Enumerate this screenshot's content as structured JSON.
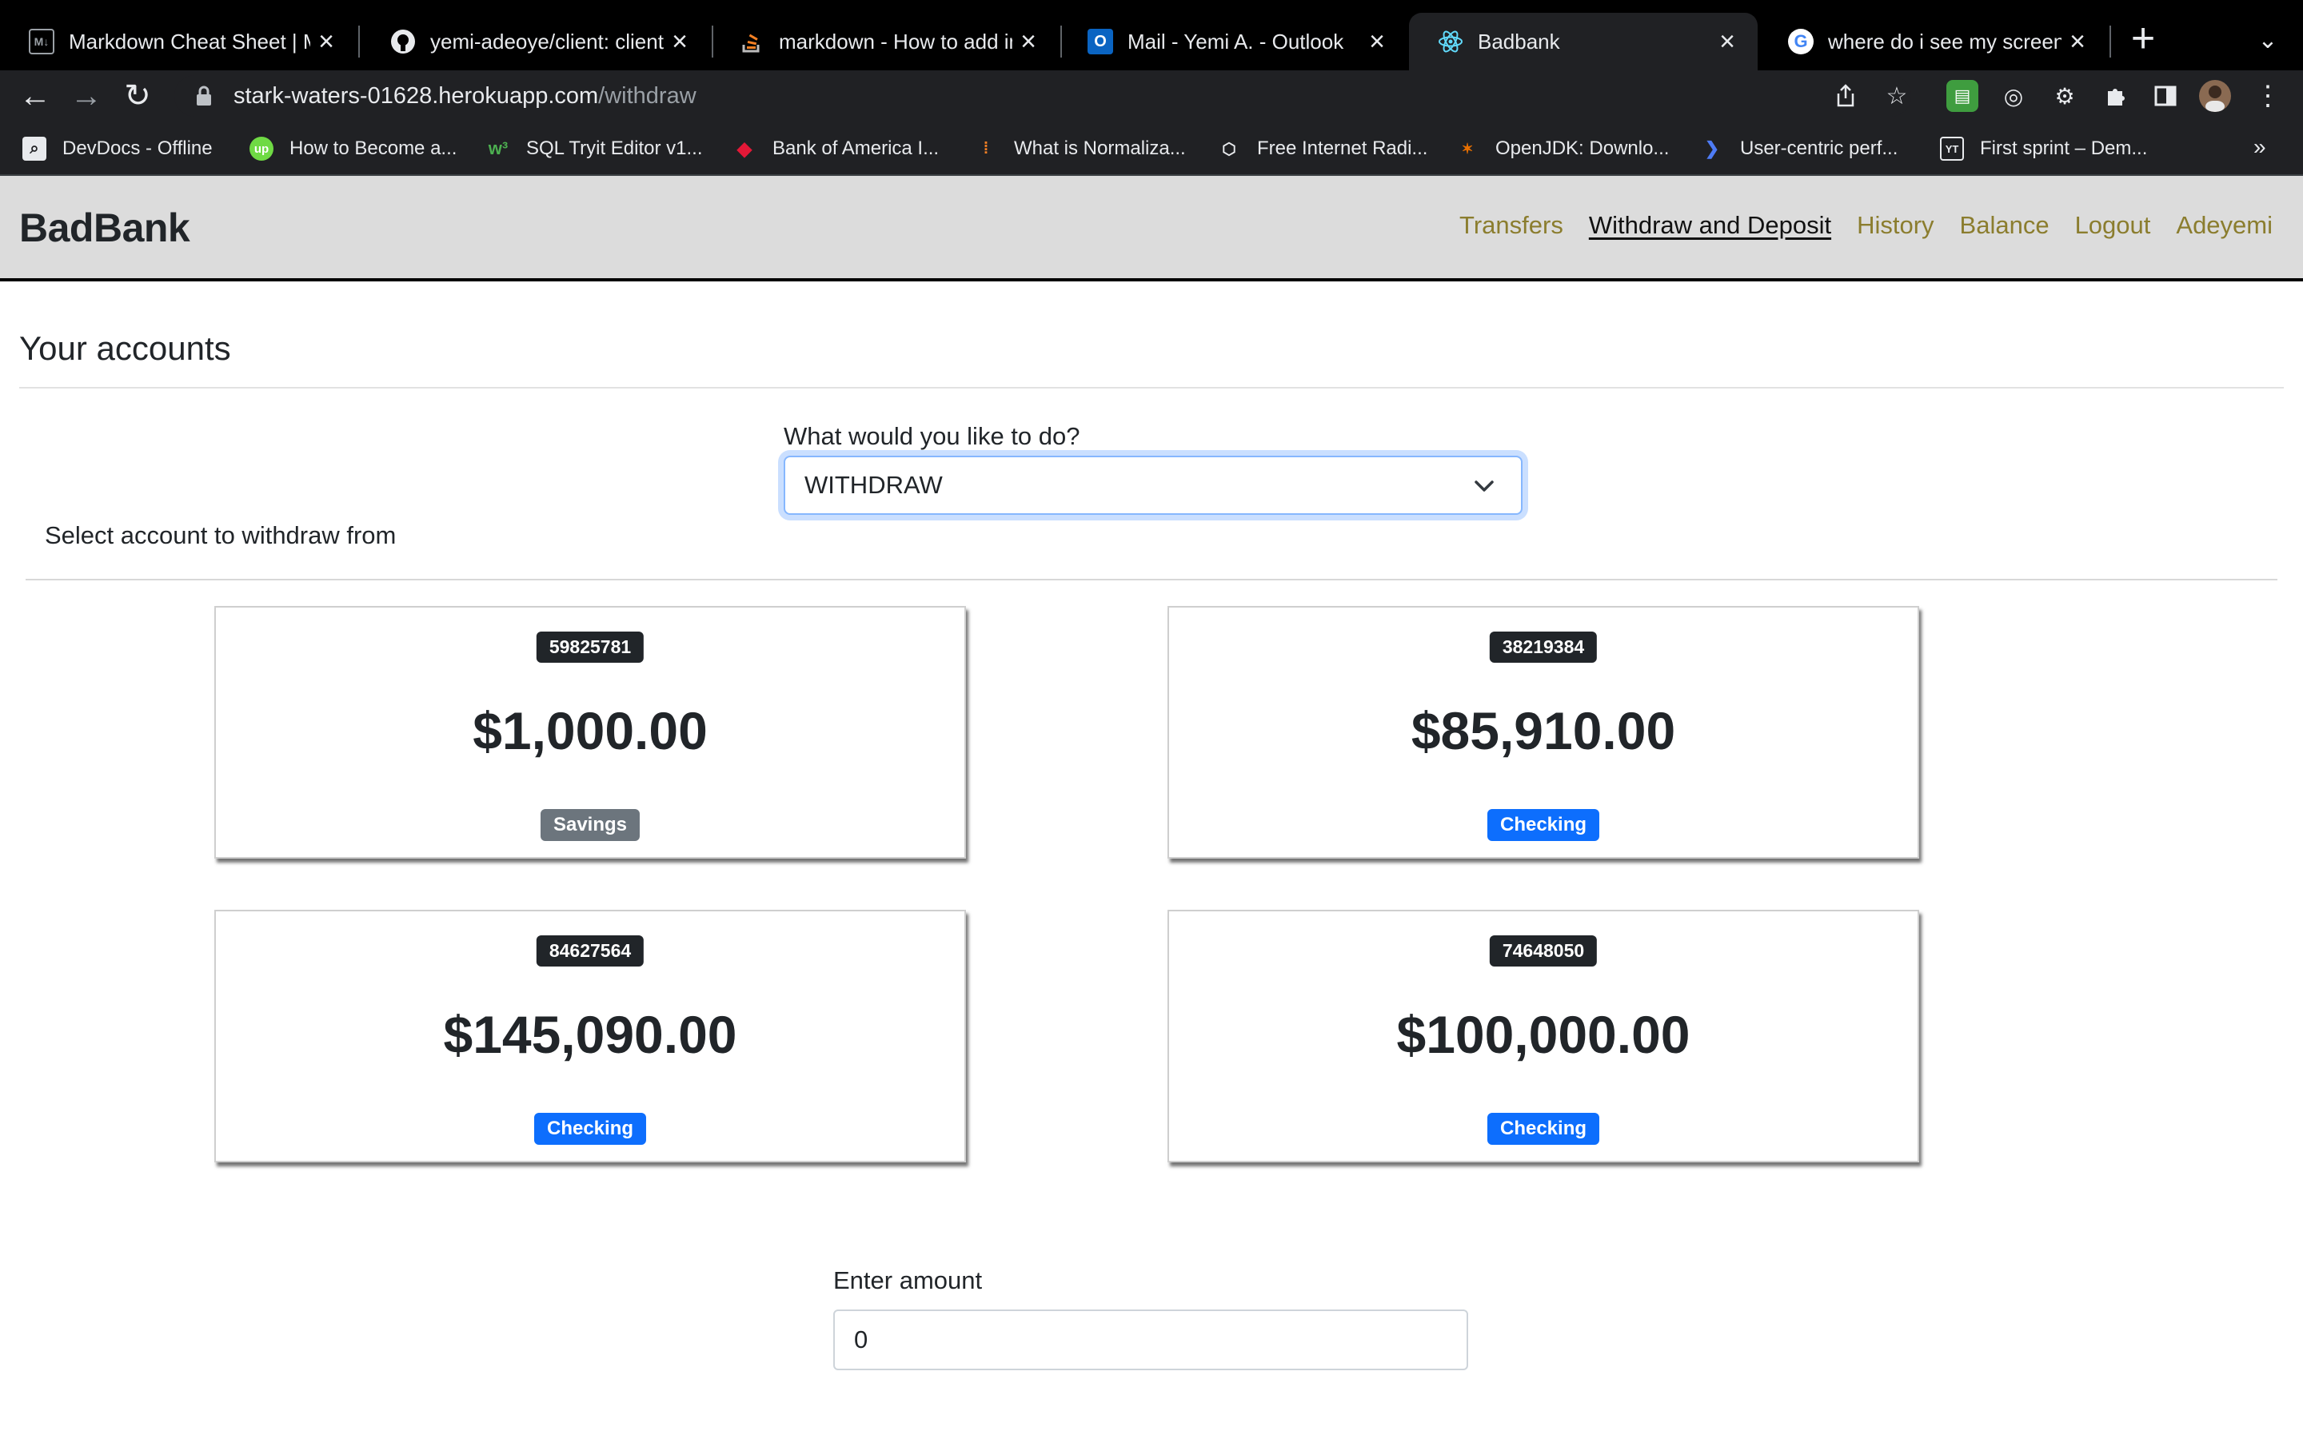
{
  "browser": {
    "tabs": [
      {
        "title": "Markdown Cheat Sheet | Ma",
        "favicon": "markdown-icon"
      },
      {
        "title": "yemi-adeoye/client: client f",
        "favicon": "github-icon"
      },
      {
        "title": "markdown - How to add im",
        "favicon": "stackoverflow-icon"
      },
      {
        "title": "Mail - Yemi A. - Outlook",
        "favicon": "outlook-icon"
      },
      {
        "title": "Badbank",
        "favicon": "react-icon"
      },
      {
        "title": "where do i see my screensh",
        "favicon": "google-icon"
      }
    ],
    "active_tab": 4,
    "url_host": "stark-waters-01628.herokuapp.com",
    "url_path": "/withdraw",
    "bookmarks": [
      {
        "label": "DevDocs - Offline"
      },
      {
        "label": "How to Become a..."
      },
      {
        "label": "SQL Tryit Editor v1..."
      },
      {
        "label": "Bank of America I..."
      },
      {
        "label": "What is Normaliza..."
      },
      {
        "label": "Free Internet Radi..."
      },
      {
        "label": "OpenJDK: Downlo..."
      },
      {
        "label": "User-centric perf..."
      },
      {
        "label": "First sprint – Dem..."
      }
    ]
  },
  "navbar": {
    "brand": "BadBank",
    "links": [
      "Transfers",
      "Withdraw and Deposit",
      "History",
      "Balance",
      "Logout",
      "Adeyemi"
    ],
    "active_link": "Withdraw and Deposit"
  },
  "page": {
    "heading": "Your accounts",
    "action_label": "What would you like to do?",
    "action_selected": "WITHDRAW",
    "select_account_text": "Select account to withdraw from",
    "accounts": [
      {
        "number": "59825781",
        "balance": "$1,000.00",
        "type": "Savings"
      },
      {
        "number": "38219384",
        "balance": "$85,910.00",
        "type": "Checking"
      },
      {
        "number": "84627564",
        "balance": "$145,090.00",
        "type": "Checking"
      },
      {
        "number": "74648050",
        "balance": "$100,000.00",
        "type": "Checking"
      }
    ],
    "amount_label": "Enter amount",
    "amount_value": "0"
  },
  "colors": {
    "nav_link": "#8b7d2e",
    "savings_badge": "#6c757d",
    "checking_badge": "#0d6efd",
    "account_badge": "#212529"
  }
}
